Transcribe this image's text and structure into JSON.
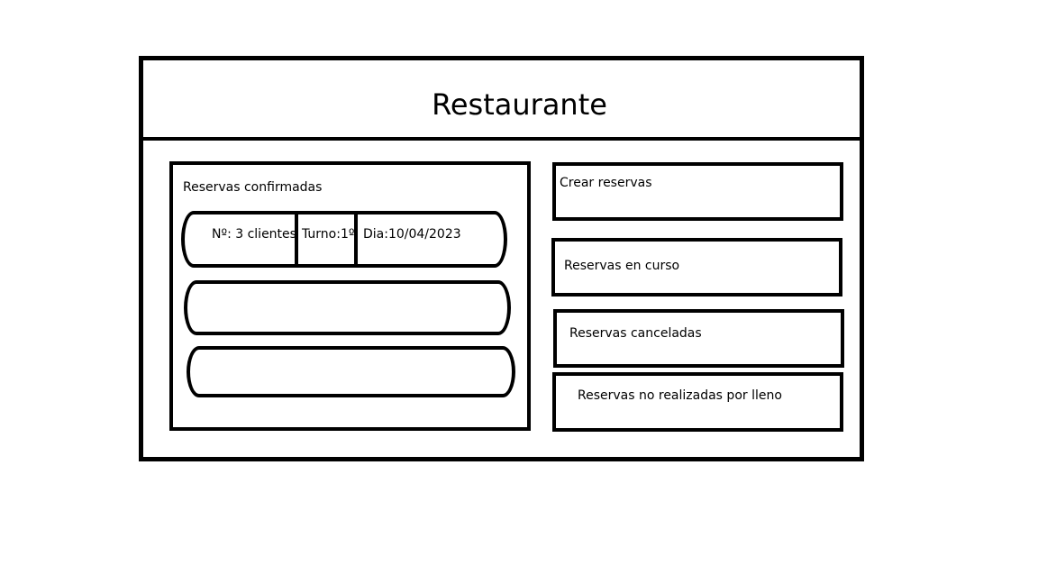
{
  "app": {
    "title": "Restaurante"
  },
  "confirmed_panel": {
    "title": "Reservas confirmadas",
    "rows": [
      {
        "clients": "Nº: 3 clientes",
        "shift": "Turno:1º",
        "date": "Dia:10/04/2023"
      },
      {
        "clients": "",
        "shift": "",
        "date": ""
      },
      {
        "clients": "",
        "shift": "",
        "date": ""
      }
    ]
  },
  "menu": {
    "items": [
      {
        "label": "Crear reservas"
      },
      {
        "label": "Reservas en curso"
      },
      {
        "label": "Reservas canceladas"
      },
      {
        "label": "Reservas no realizadas por lleno"
      }
    ]
  },
  "colors": {
    "border": "#000000",
    "background": "#ffffff",
    "text": "#000000"
  }
}
